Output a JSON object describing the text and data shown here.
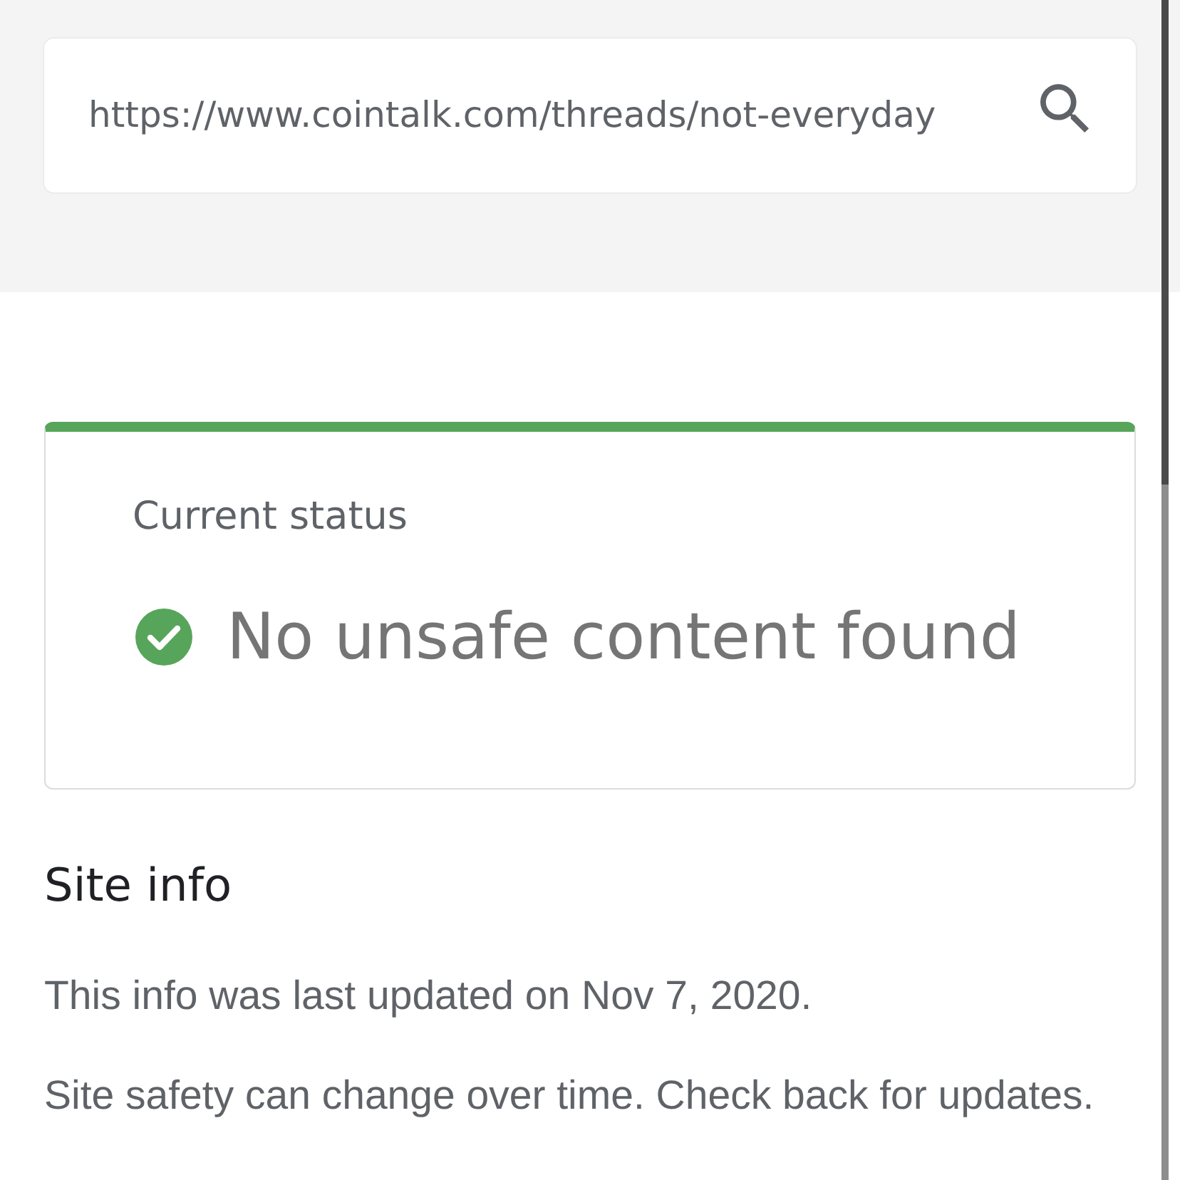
{
  "search": {
    "value": "https://www.cointalk.com/threads/not-everyday"
  },
  "status_card": {
    "label": "Current status",
    "safe": true,
    "message": "No unsafe content found"
  },
  "site_info": {
    "title": "Site info",
    "paragraphs": [
      "This info was last updated on Nov 7, 2020.",
      "Site safety can change over time. Check back for updates."
    ]
  }
}
